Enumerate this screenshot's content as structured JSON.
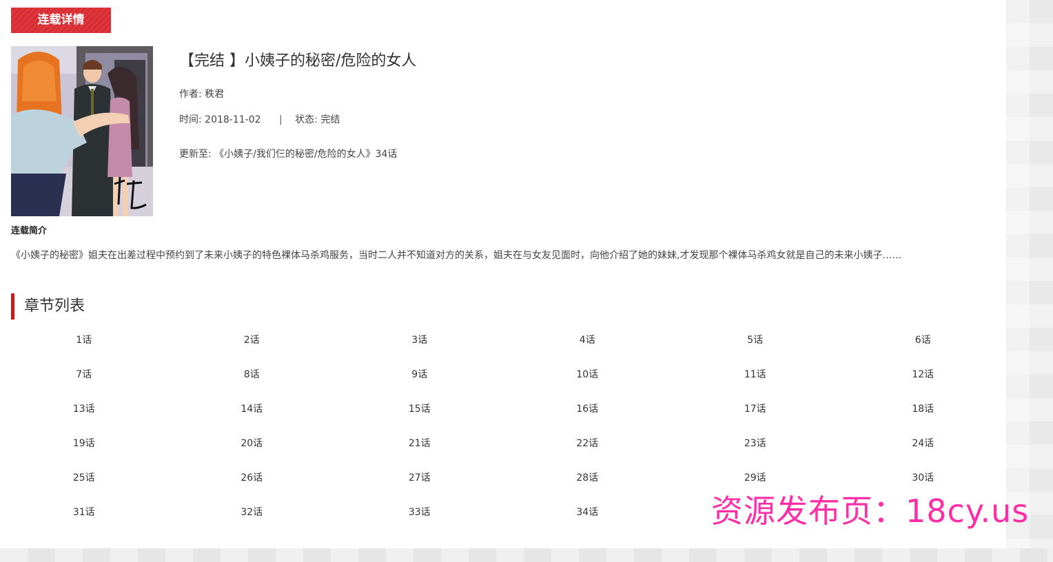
{
  "header": {
    "tab_title": "连载详情"
  },
  "comic": {
    "title": "【完结 】小姨子的秘密/危险的女人",
    "author_label": "作者:",
    "author": "秩君",
    "time_label": "时间:",
    "time": "2018-11-02",
    "separator": "|",
    "status_label": "状态:",
    "status": "完结",
    "update_label": "更新至:",
    "update_value": "《小姨子/我们仨的秘密/危险的女人》34话"
  },
  "intro": {
    "heading": "连载简介",
    "text": "《小姨子的秘密》姐夫在出差过程中预约到了未来小姨子的特色裸体马杀鸡服务，当时二人并不知道对方的关系，姐夫在与女友见面时，向他介绍了她的妹妹,才发现那个裸体马杀鸡女就是自己的未来小姨子……"
  },
  "chapters": {
    "heading": "章节列表",
    "items": [
      "1话",
      "2话",
      "3话",
      "4话",
      "5话",
      "6话",
      "7话",
      "8话",
      "9话",
      "10话",
      "11话",
      "12话",
      "13话",
      "14话",
      "15话",
      "16话",
      "17话",
      "18话",
      "19话",
      "20话",
      "21话",
      "22话",
      "23话",
      "24话",
      "25话",
      "26话",
      "27话",
      "28话",
      "29话",
      "30话",
      "31话",
      "32话",
      "33话",
      "34话"
    ]
  },
  "watermark": "资源发布页：18cy.us",
  "colors": {
    "accent": "#cc1a1a",
    "tab_bg": "#e0363c",
    "watermark": "#ff2ea6"
  }
}
